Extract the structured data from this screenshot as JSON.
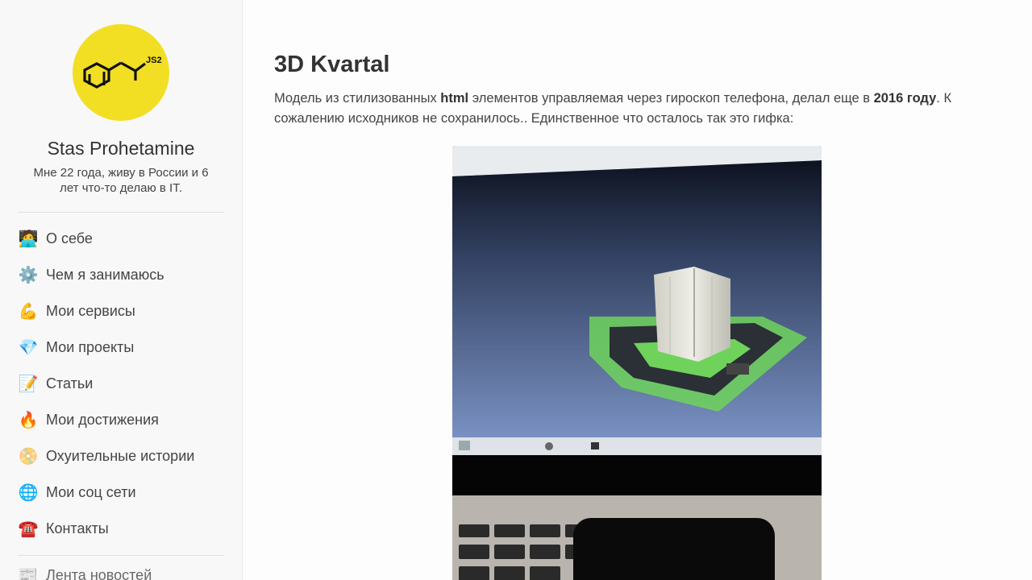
{
  "profile": {
    "logo_label": "JS2",
    "logo_sub": "2",
    "name": "Stas Prohetamine",
    "bio": "Мне 22 года, живу в России и 6 лет что-то делаю в IT."
  },
  "nav": [
    {
      "icon": "technologist-icon",
      "emoji": "🧑‍💻",
      "label": "О себе"
    },
    {
      "icon": "gear-icon",
      "emoji": "⚙️",
      "label": "Чем я занимаюсь"
    },
    {
      "icon": "flexed-biceps-icon",
      "emoji": "💪",
      "label": "Мои сервисы"
    },
    {
      "icon": "gem-icon",
      "emoji": "💎",
      "label": "Мои проекты"
    },
    {
      "icon": "memo-icon",
      "emoji": "📝",
      "label": "Статьи"
    },
    {
      "icon": "fire-icon",
      "emoji": "🔥",
      "label": "Мои достижения"
    },
    {
      "icon": "dvd-icon",
      "emoji": "📀",
      "label": "Охуительные истории"
    },
    {
      "icon": "globe-icon",
      "emoji": "🌐",
      "label": "Мои соц сети"
    },
    {
      "icon": "telephone-icon",
      "emoji": "☎️",
      "label": "Контакты"
    }
  ],
  "nav_extra": {
    "icon": "newspaper-icon",
    "emoji": "📰",
    "label": "Лента новостей"
  },
  "article": {
    "title": "3D Kvartal",
    "p1": "Модель из стилизованных ",
    "b1": "html",
    "p2": " элементов управляемая через гироскоп телефона, делал еще в ",
    "b2": "2016 году",
    "p3": ". К сожалению исходников не сохранилось.. Единственное что осталось так это гифка:"
  },
  "colors": {
    "logo_bg": "#f2de23",
    "gif_screen": "#5a6b93",
    "gif_green": "#6fd35b"
  }
}
